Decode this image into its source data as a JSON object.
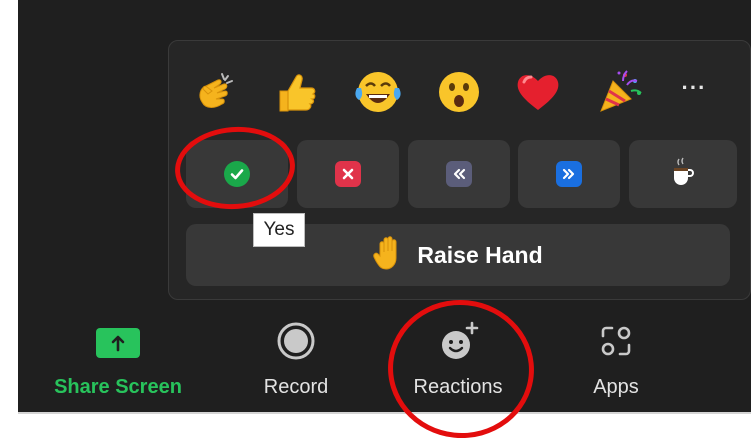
{
  "reactions": {
    "emojis": [
      "clapping-hands",
      "thumbs-up",
      "tears-of-joy",
      "open-mouth",
      "red-heart",
      "party-popper"
    ],
    "more_label": "···",
    "replies": [
      {
        "name": "yes",
        "color": "#1aa84a",
        "glyph": "✓"
      },
      {
        "name": "no",
        "color": "#e0334a",
        "glyph": "✕"
      },
      {
        "name": "slower",
        "color": "#5b5d7a",
        "glyph": "‹‹"
      },
      {
        "name": "faster",
        "color": "#1a6fe0",
        "glyph": "››"
      },
      {
        "name": "coffee",
        "color": "#ffffff",
        "glyph": "☕"
      }
    ],
    "tooltip": "Yes",
    "raise_hand_label": "Raise Hand"
  },
  "toolbar": {
    "share_screen": "Share Screen",
    "record": "Record",
    "reactions": "Reactions",
    "apps": "Apps"
  },
  "colors": {
    "share_green": "#28c35c",
    "annotation_red": "#e30d0d",
    "background": "#1f1f1f"
  }
}
